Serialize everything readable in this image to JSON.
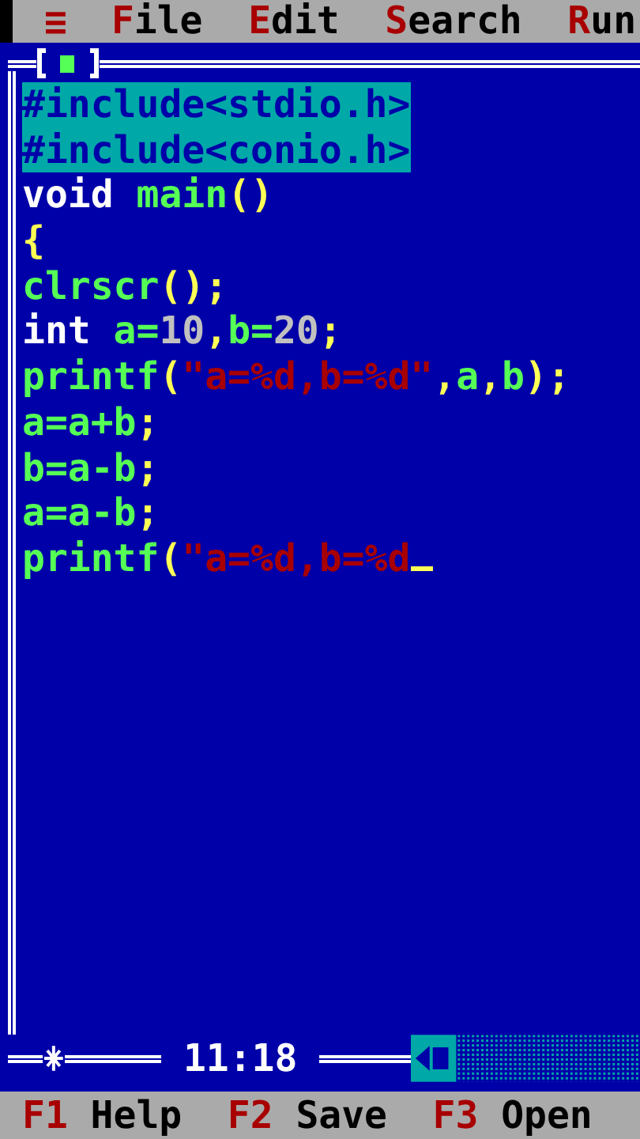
{
  "menu_bar": {
    "system_menu": "≡",
    "items": [
      {
        "label": "File"
      },
      {
        "label": "Edit"
      },
      {
        "label": "Search"
      },
      {
        "label": "Run"
      }
    ]
  },
  "editor": {
    "lines": [
      {
        "selected": true,
        "tokens": [
          {
            "kind": "directive",
            "text": "#include<stdio.h>"
          }
        ]
      },
      {
        "selected": true,
        "tokens": [
          {
            "kind": "directive",
            "text": "#include<conio.h>"
          }
        ]
      },
      {
        "selected": false,
        "tokens": [
          {
            "kind": "keyword",
            "text": "void "
          },
          {
            "kind": "ident",
            "text": "main"
          },
          {
            "kind": "punct",
            "text": "()"
          }
        ]
      },
      {
        "selected": false,
        "tokens": [
          {
            "kind": "punct",
            "text": "{"
          }
        ]
      },
      {
        "selected": false,
        "tokens": [
          {
            "kind": "ident",
            "text": "clrscr"
          },
          {
            "kind": "punct",
            "text": "();"
          }
        ]
      },
      {
        "selected": false,
        "tokens": [
          {
            "kind": "keyword",
            "text": "int "
          },
          {
            "kind": "ident",
            "text": "a="
          },
          {
            "kind": "number",
            "text": "10"
          },
          {
            "kind": "punct",
            "text": ","
          },
          {
            "kind": "ident",
            "text": "b="
          },
          {
            "kind": "number",
            "text": "20"
          },
          {
            "kind": "punct",
            "text": ";"
          }
        ]
      },
      {
        "selected": false,
        "tokens": [
          {
            "kind": "ident",
            "text": "printf"
          },
          {
            "kind": "punct",
            "text": "("
          },
          {
            "kind": "string",
            "text": "\"a=%d,b=%d\""
          },
          {
            "kind": "punct",
            "text": ","
          },
          {
            "kind": "ident",
            "text": "a"
          },
          {
            "kind": "punct",
            "text": ","
          },
          {
            "kind": "ident",
            "text": "b"
          },
          {
            "kind": "punct",
            "text": ");"
          }
        ]
      },
      {
        "selected": false,
        "tokens": [
          {
            "kind": "ident",
            "text": "a=a+b"
          },
          {
            "kind": "punct",
            "text": ";"
          }
        ]
      },
      {
        "selected": false,
        "tokens": [
          {
            "kind": "ident",
            "text": "b=a-b"
          },
          {
            "kind": "punct",
            "text": ";"
          }
        ]
      },
      {
        "selected": false,
        "tokens": [
          {
            "kind": "ident",
            "text": "a=a-b"
          },
          {
            "kind": "punct",
            "text": ";"
          }
        ]
      },
      {
        "selected": false,
        "cursor": true,
        "tokens": [
          {
            "kind": "ident",
            "text": "printf"
          },
          {
            "kind": "punct",
            "text": "("
          },
          {
            "kind": "string",
            "text": "\"a=%d,b=%d"
          }
        ]
      }
    ],
    "clock": "11:18"
  },
  "status_bar": [
    {
      "key": "F1",
      "label": "Help"
    },
    {
      "key": "F2",
      "label": "Save"
    },
    {
      "key": "F3",
      "label": "Open"
    }
  ]
}
